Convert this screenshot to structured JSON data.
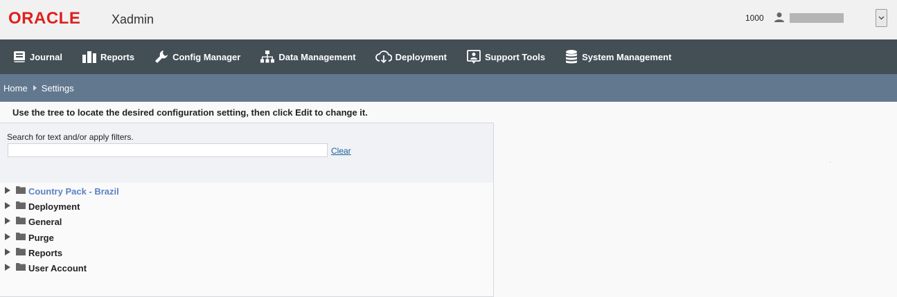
{
  "header": {
    "logo": "ORACLE",
    "app_name": "Xadmin",
    "store_number": "1000",
    "user_icon": "user-icon",
    "dropdown_icon": "chevron-down-icon"
  },
  "nav": {
    "items": [
      {
        "label": "Journal",
        "icon": "journal-icon"
      },
      {
        "label": "Reports",
        "icon": "bar-chart-icon"
      },
      {
        "label": "Config Manager",
        "icon": "wrench-icon"
      },
      {
        "label": "Data Management",
        "icon": "hierarchy-icon"
      },
      {
        "label": "Deployment",
        "icon": "cloud-download-icon"
      },
      {
        "label": "Support Tools",
        "icon": "support-icon"
      },
      {
        "label": "System Management",
        "icon": "database-icon"
      }
    ]
  },
  "breadcrumb": {
    "home": "Home",
    "current": "Settings"
  },
  "instruction": "Use the tree to locate the desired configuration setting, then click Edit to change it.",
  "filter": {
    "label": "Search for text and/or apply filters.",
    "search_value": "",
    "clear_label": "Clear"
  },
  "tree": {
    "items": [
      {
        "label": "Country Pack - Brazil",
        "active": true
      },
      {
        "label": "Deployment",
        "active": false
      },
      {
        "label": "General",
        "active": false
      },
      {
        "label": "Purge",
        "active": false
      },
      {
        "label": "Reports",
        "active": false
      },
      {
        "label": "User Account",
        "active": false
      }
    ]
  },
  "colors": {
    "brand_red": "#e01f1f",
    "navbar": "#434e55",
    "breadcrumb_bar": "#61788f",
    "active_tree_item": "#5b82c6"
  }
}
